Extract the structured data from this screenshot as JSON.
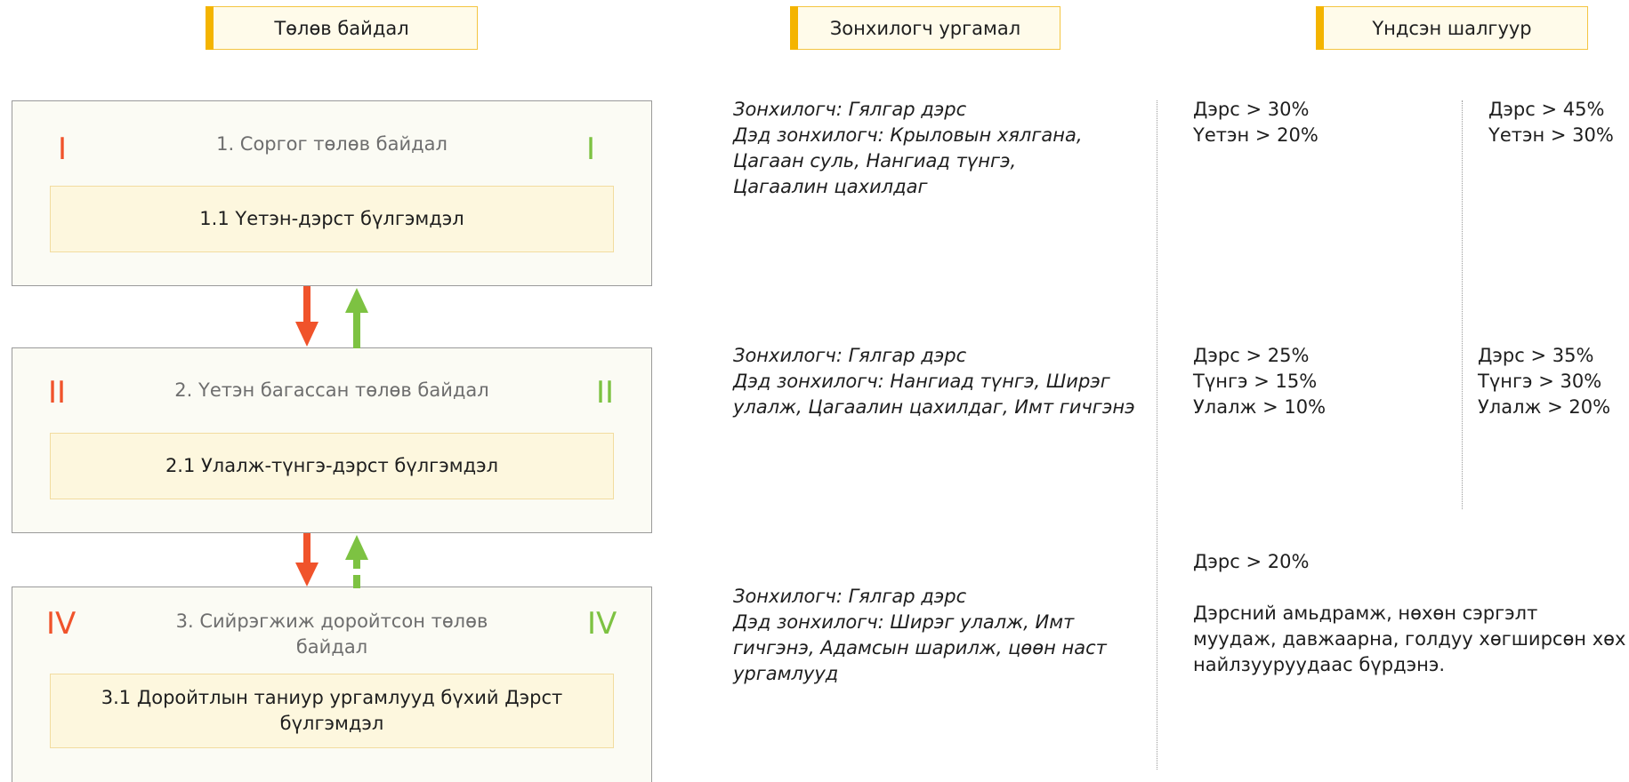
{
  "headers": {
    "state": "Төлөв байдал",
    "species": "Зонхилогч ургамал",
    "criteria": "Үндсэн шалгуур"
  },
  "states": [
    {
      "roman_left": "I",
      "roman_right": "I",
      "title": "1. Соргог төлөв байдал",
      "community": "1.1 Үетэн-дэрст бүлгэмдэл",
      "species": [
        "Зонхилогч: Гялгар дэрс",
        "Дэд зонхилогч: Крыловын хялгана,",
        "Цагаан суль, Нангиад түнгэ,",
        "Цагаалин цахилдаг"
      ],
      "criteria_a": [
        "Дэрс > 30%",
        "Үетэн > 20%"
      ],
      "criteria_b": [
        "Дэрс > 45%",
        "Үетэн > 30%"
      ]
    },
    {
      "roman_left": "II",
      "roman_right": "II",
      "title": "2. Үетэн багассан төлөв байдал",
      "community": "2.1 Улалж-түнгэ-дэрст бүлгэмдэл",
      "species": [
        "Зонхилогч: Гялгар дэрс",
        "Дэд зонхилогч: Нангиад түнгэ, Ширэг",
        "улалж, Цагаалин цахилдаг, Имт гичгэнэ"
      ],
      "criteria_a": [
        "Дэрс > 25%",
        "Түнгэ > 15%",
        "Улалж > 10%"
      ],
      "criteria_b": [
        "Дэрс > 35%",
        "Түнгэ > 30%",
        "Улалж > 20%"
      ]
    },
    {
      "roman_left": "IV",
      "roman_right": "IV",
      "title": "3. Сийрэгжиж доройтсон төлөв байдал",
      "community": "3.1 Доройтлын таниур ургамлууд бүхий Дэрст бүлгэмдэл",
      "species": [
        "Зонхилогч: Гялгар дэрс",
        "Дэд зонхилогч: Ширэг улалж, Имт",
        "гичгэнэ, Адамсын шарилж, цөөн наст",
        "ургамлууд"
      ],
      "criteria_single": "Дэрс > 20%",
      "criteria_note": [
        "Дэрсний амьдрамж, нөхөн сэргэлт",
        "муудаж, давжаарна, голдуу хөгширсөн хөх",
        "найлзууруудаас бүрдэнэ."
      ]
    }
  ],
  "colors": {
    "degrade_arrow": "#f0532b",
    "recover_arrow": "#7dc242",
    "header_accent": "#f4b400"
  }
}
